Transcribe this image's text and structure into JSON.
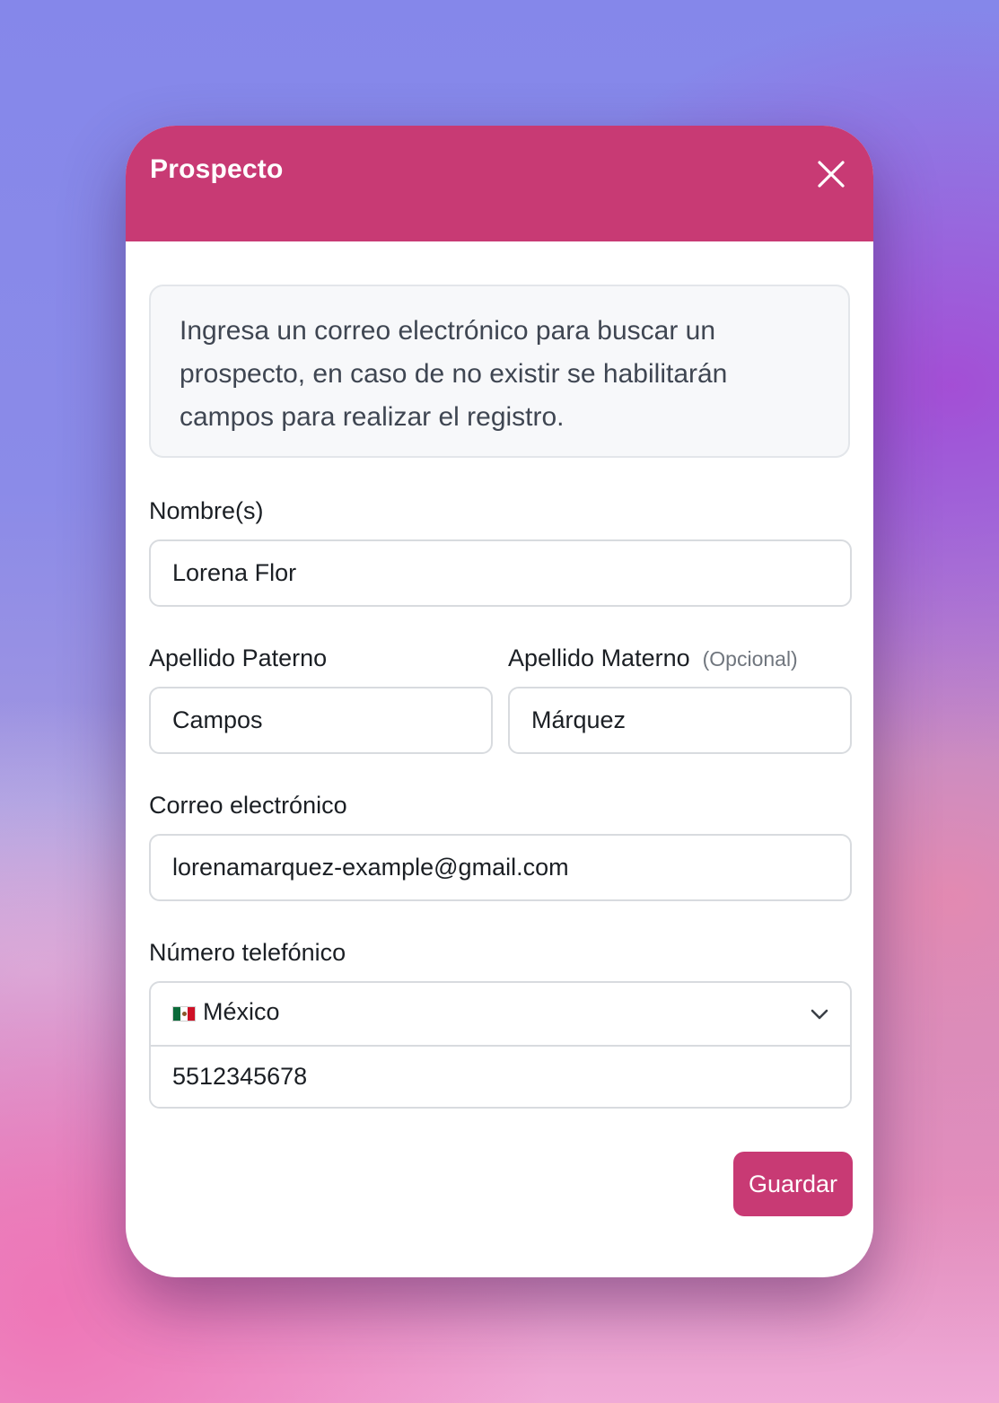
{
  "modal": {
    "title": "Prospecto",
    "close_icon": "close-icon",
    "info_text": "Ingresa un correo electrónico para buscar un prospecto, en caso de no existir se habilitarán campos para realizar el registro."
  },
  "form": {
    "nombre": {
      "label": "Nombre(s)",
      "value": "Lorena Flor"
    },
    "apellido_paterno": {
      "label": "Apellido Paterno",
      "value": "Campos"
    },
    "apellido_materno": {
      "label": "Apellido Materno",
      "optional": "(Opcional)",
      "value": "Márquez"
    },
    "correo": {
      "label": "Correo electrónico",
      "value": "lorenamarquez-example@gmail.com"
    },
    "telefono": {
      "label": "Número telefónico",
      "country": "México",
      "country_flag_icon": "mexico-flag-icon",
      "value": "5512345678"
    },
    "save_label": "Guardar"
  },
  "colors": {
    "accent": "#c83a74",
    "border": "#d8dbdf",
    "info_bg": "#f7f8fa"
  }
}
